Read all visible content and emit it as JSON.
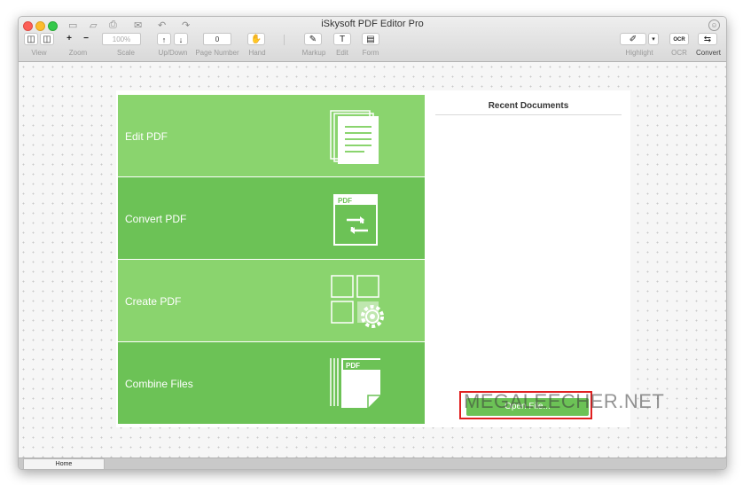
{
  "window": {
    "title": "iSkysoft PDF Editor Pro"
  },
  "toolbar": {
    "view_label": "View",
    "zoom_label": "Zoom",
    "zoom_in": "+",
    "zoom_out": "−",
    "scale_value": "100%",
    "scale_label": "Scale",
    "updown_label": "Up/Down",
    "up_arrow": "↑",
    "down_arrow": "↓",
    "page_number_value": "0",
    "page_number_label": "Page Number",
    "hand_label": "Hand",
    "markup_label": "Markup",
    "edit_label": "Edit",
    "form_label": "Form",
    "highlight_label": "Highlight",
    "ocr_label": "OCR",
    "convert_label": "Convert",
    "ocr_icon_text": "OCR"
  },
  "tiles": [
    {
      "label": "Edit PDF",
      "icon": "document-stack-icon"
    },
    {
      "label": "Convert PDF",
      "icon": "pdf-convert-icon",
      "badge": "PDF"
    },
    {
      "label": "Create PDF",
      "icon": "create-grid-gear-icon"
    },
    {
      "label": "Combine Files",
      "icon": "pdf-combine-icon",
      "badge": "PDF"
    }
  ],
  "recent": {
    "title": "Recent Documents"
  },
  "open_button": {
    "label": "Open File..."
  },
  "watermark": "MEGALEECHER.NET",
  "tabs": {
    "home": "Home"
  },
  "colors": {
    "tile_light": "#8ad46e",
    "tile_dark": "#6cc256",
    "highlight_box": "#e02020"
  }
}
